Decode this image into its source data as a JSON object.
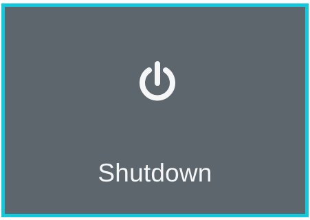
{
  "tile": {
    "label": "Shutdown",
    "icon": "power-icon",
    "colors": {
      "background": "#5d666c",
      "border_focus": "#12c9dc",
      "foreground": "#f4f6f7"
    }
  }
}
